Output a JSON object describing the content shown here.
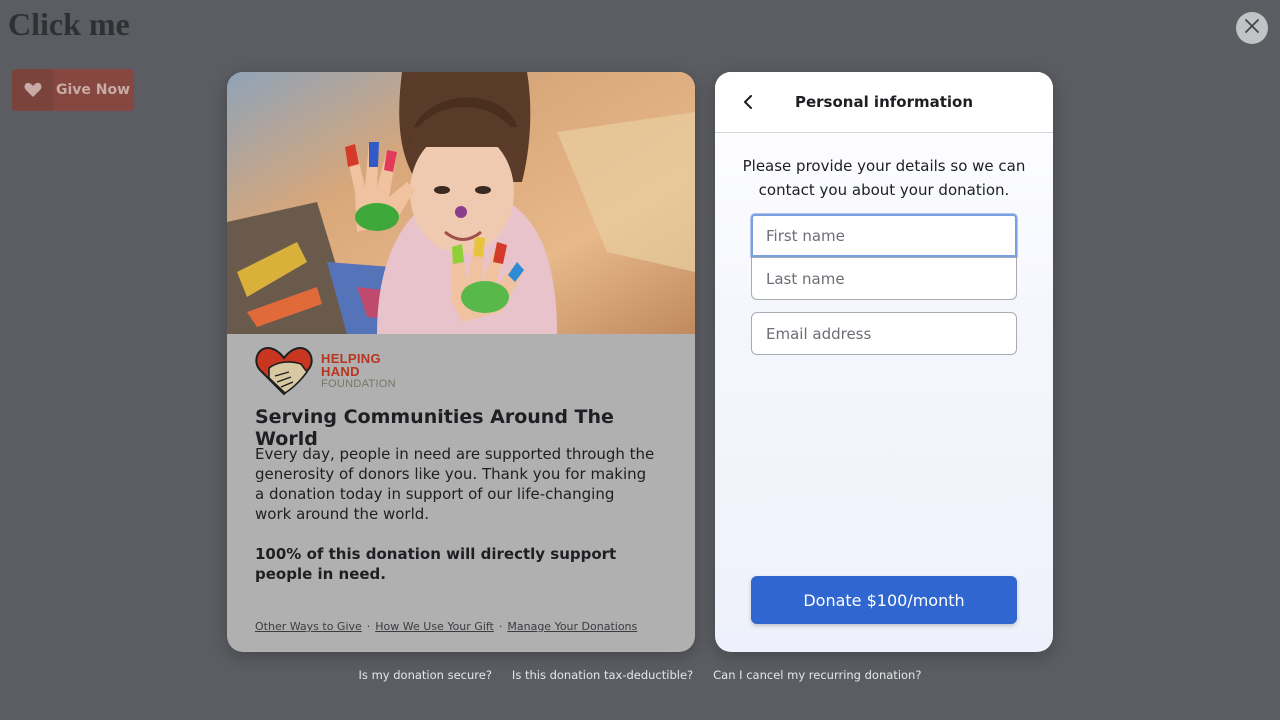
{
  "page": {
    "title": "Click me"
  },
  "give_button": {
    "label": "Give Now",
    "icon": "heart-icon"
  },
  "close_button": {
    "icon": "close-icon"
  },
  "campaign": {
    "logo": {
      "line1": "HELPING",
      "line2": "HAND",
      "line3": "FOUNDATION"
    },
    "heading": "Serving Communities Around The World",
    "body": "Every day, people in need are supported through the generosity of donors like you. Thank you for making a donation today in support of our life-changing work around the world.",
    "highlight": "100% of this donation will directly support people in need.",
    "links": [
      "Other Ways to Give",
      "How We Use Your Gift",
      "Manage Your Donations"
    ]
  },
  "form": {
    "title": "Personal information",
    "back_icon": "chevron-left-icon",
    "instructions": "Please provide your details so we can contact you about your donation.",
    "first_name": {
      "placeholder": "First name",
      "value": ""
    },
    "last_name": {
      "placeholder": "Last name",
      "value": ""
    },
    "email": {
      "placeholder": "Email address",
      "value": ""
    },
    "submit_label": "Donate $100/month"
  },
  "faq": [
    "Is my donation secure?",
    "Is this donation tax-deductible?",
    "Can I cancel my recurring donation?"
  ],
  "colors": {
    "overlay": "#5b5d62",
    "brand_red": "#b8351f",
    "primary_button": "#2f66d0",
    "focus_ring": "#7a9fe0"
  }
}
